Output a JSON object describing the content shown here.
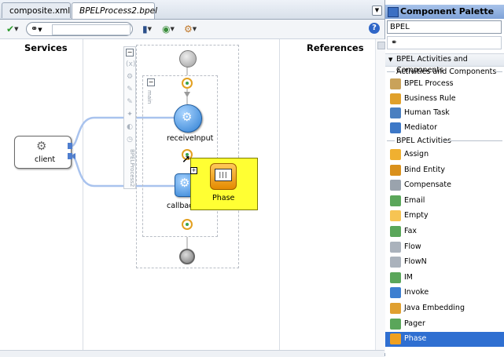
{
  "tabs": [
    {
      "label": "composite.xml",
      "active": false
    },
    {
      "label": "BPELProcess2.bpel",
      "active": true
    }
  ],
  "columns": {
    "services": "Services",
    "references": "References"
  },
  "diagram": {
    "client_label": "client",
    "receive_label": "receiveInput",
    "callback_label": "callbackClient",
    "scope_label": "main",
    "process_label": "BPELProcess2",
    "drag_preview_label": "Phase",
    "drag_preview_icon_text": "|||"
  },
  "palette": {
    "title": "Component Palette",
    "selected_page": "BPEL",
    "sections": [
      {
        "label": "BPEL Activities and Components"
      }
    ],
    "subsections": {
      "activities_components": "Activities and Components",
      "bpel_activities": "BPEL Activities"
    },
    "components": [
      {
        "label": "BPEL Process",
        "color": "#c9a25a"
      },
      {
        "label": "Business Rule",
        "color": "#e0a02a"
      },
      {
        "label": "Human Task",
        "color": "#4a7fc0"
      },
      {
        "label": "Mediator",
        "color": "#3d78c7"
      }
    ],
    "activities": [
      {
        "label": "Assign",
        "color": "#f0b030"
      },
      {
        "label": "Bind Entity",
        "color": "#d9901c"
      },
      {
        "label": "Compensate",
        "color": "#9aa3ad"
      },
      {
        "label": "Email",
        "color": "#5aa65a"
      },
      {
        "label": "Empty",
        "color": "#f6c453"
      },
      {
        "label": "Fax",
        "color": "#5aa65a"
      },
      {
        "label": "Flow",
        "color": "#aab2bc"
      },
      {
        "label": "FlowN",
        "color": "#aab2bc"
      },
      {
        "label": "IM",
        "color": "#5aa65a"
      },
      {
        "label": "Invoke",
        "color": "#3d7fd0"
      },
      {
        "label": "Java Embedding",
        "color": "#e0a030"
      },
      {
        "label": "Pager",
        "color": "#5aa65a"
      },
      {
        "label": "Phase",
        "color": "#f0a020",
        "selected": true
      }
    ]
  }
}
